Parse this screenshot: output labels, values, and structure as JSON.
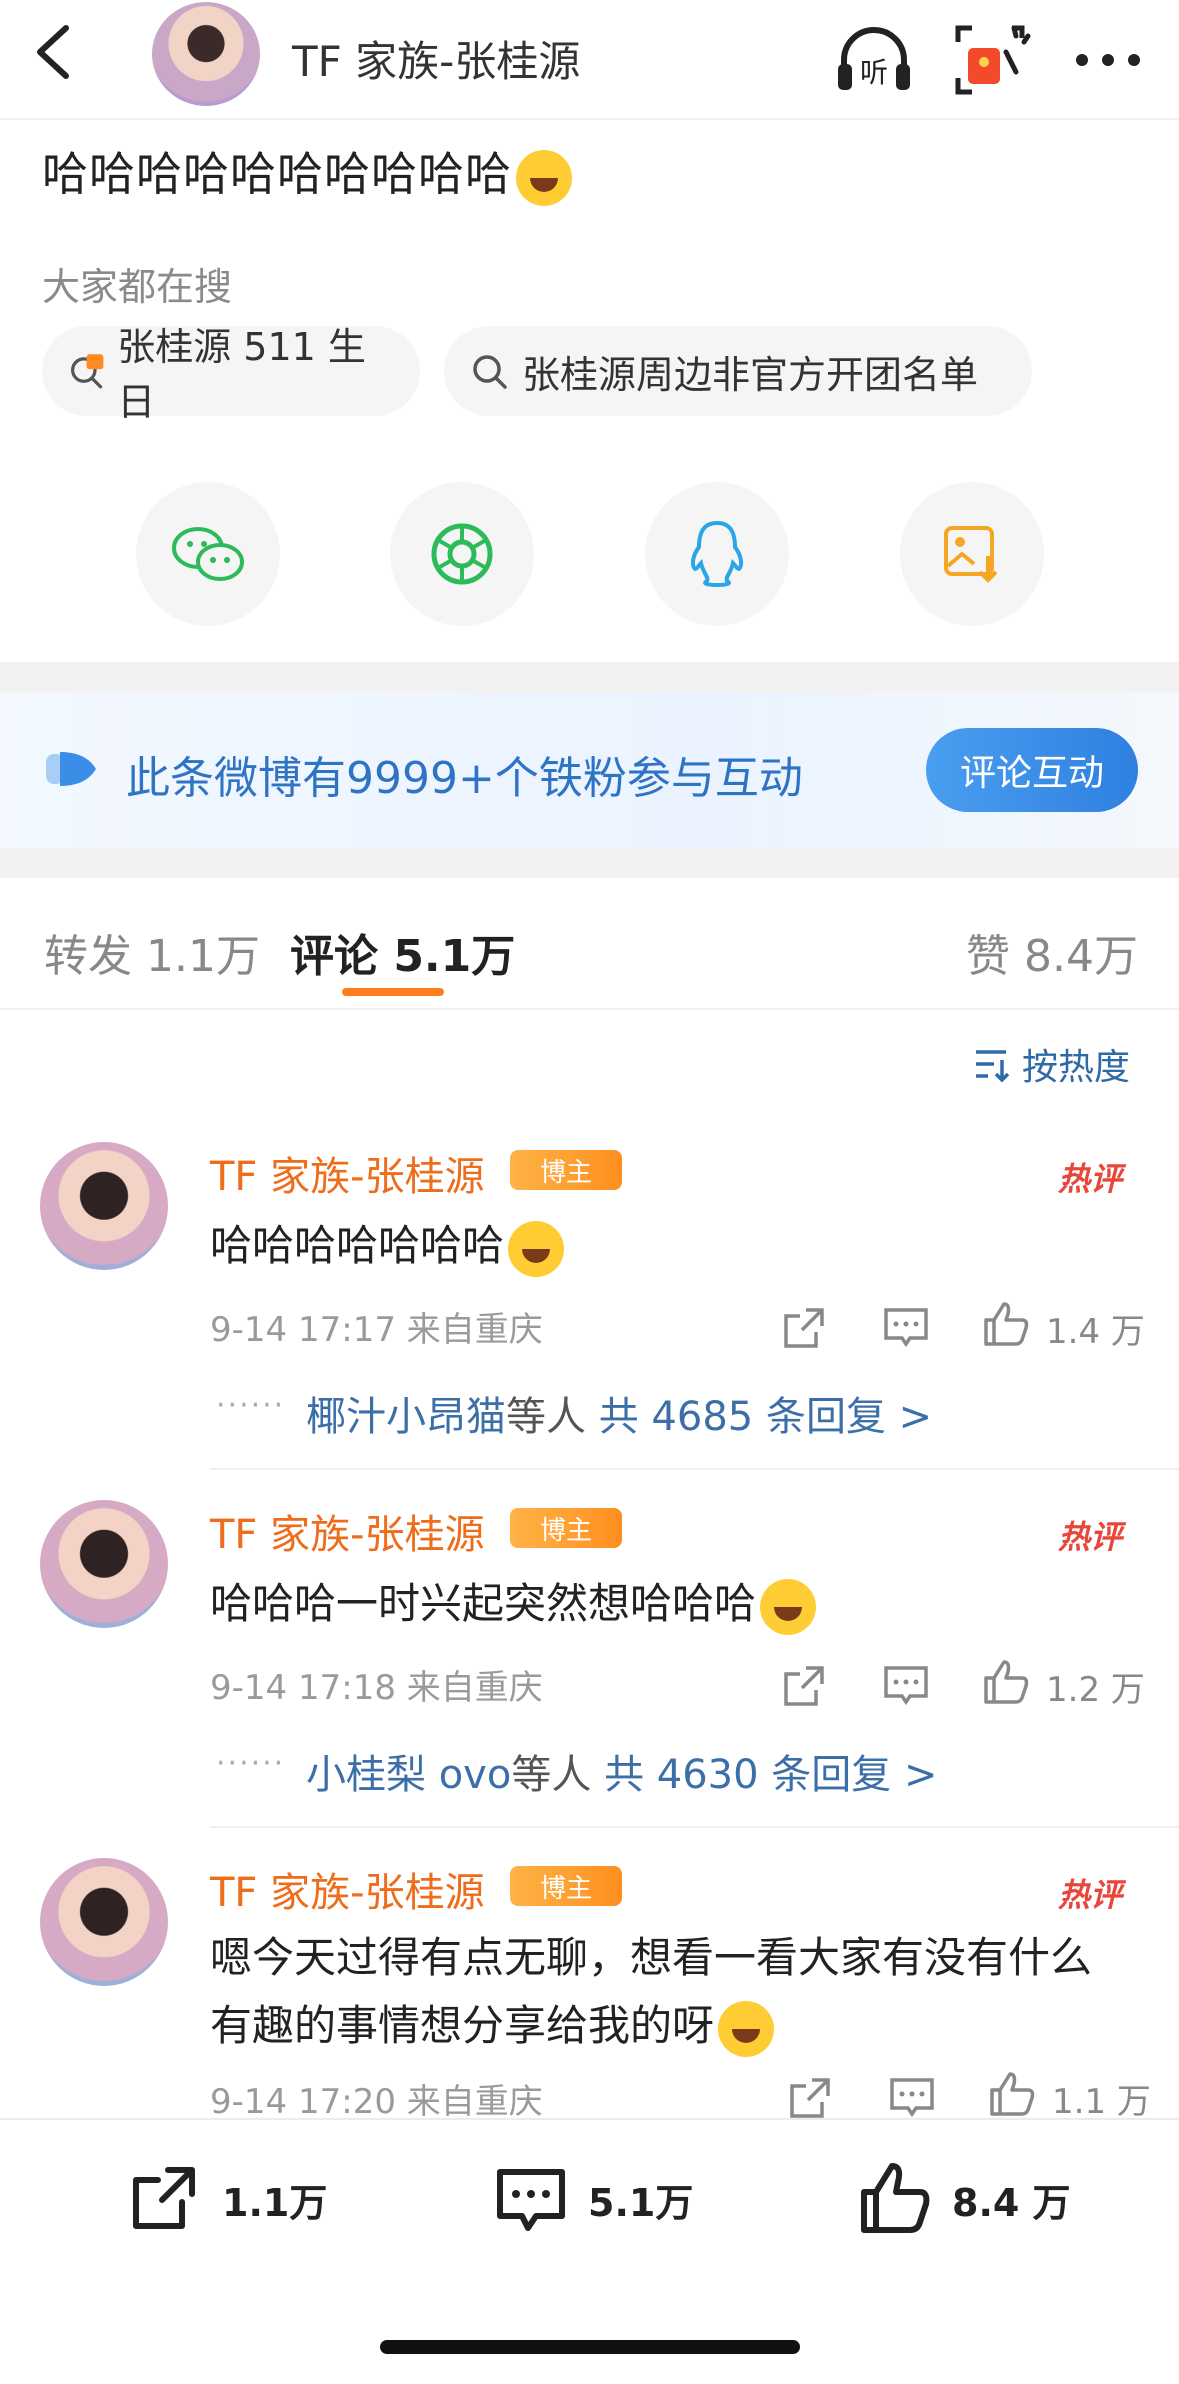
{
  "header": {
    "title": "TF 家族-张桂源",
    "listen_label": "听"
  },
  "post": {
    "text": "哈哈哈哈哈哈哈哈哈哈"
  },
  "search": {
    "title": "大家都在搜",
    "chips": [
      {
        "label": "张桂源 511 生日",
        "icon": "hot-search-icon"
      },
      {
        "label": "张桂源周边非官方开团名单",
        "icon": "search-icon"
      }
    ]
  },
  "share": [
    "wechat-icon",
    "moments-icon",
    "qq-icon",
    "save-image-icon"
  ],
  "banner": {
    "text": "此条微博有9999+个铁粉参与互动",
    "button": "评论互动"
  },
  "tabs": {
    "repost": "转发 1.1万",
    "comment": "评论 5.1万",
    "like": "赞 8.4万"
  },
  "sort_label": "按热度",
  "comments": [
    {
      "name": "TF 家族-张桂源",
      "badge": "博主",
      "hot": "热评",
      "text": "哈哈哈哈哈哈哈",
      "time": "9-14 17:17",
      "location": "来自重庆",
      "likes": "1.4 万",
      "reply_users": "椰汁小昂猫",
      "reply_suffix": "等人",
      "reply_count": "共 4685 条回复 >"
    },
    {
      "name": "TF 家族-张桂源",
      "badge": "博主",
      "hot": "热评",
      "text": "哈哈哈一时兴起突然想哈哈哈",
      "time": "9-14 17:18",
      "location": "来自重庆",
      "likes": "1.2 万",
      "reply_users": "小桂梨 ovo",
      "reply_suffix": "等人",
      "reply_count": "共 4630 条回复 >"
    },
    {
      "name": "TF 家族-张桂源",
      "badge": "博主",
      "hot": "热评",
      "text": "嗯今天过得有点无聊，想看一看大家有没有什么有趣的事情想分享给我的呀",
      "time": "9-14 17:20",
      "location": "来自重庆",
      "likes": "1.1 万"
    }
  ],
  "bottom_bar": {
    "repost": "1.1万",
    "comment": "5.1万",
    "like": "8.4 万"
  }
}
